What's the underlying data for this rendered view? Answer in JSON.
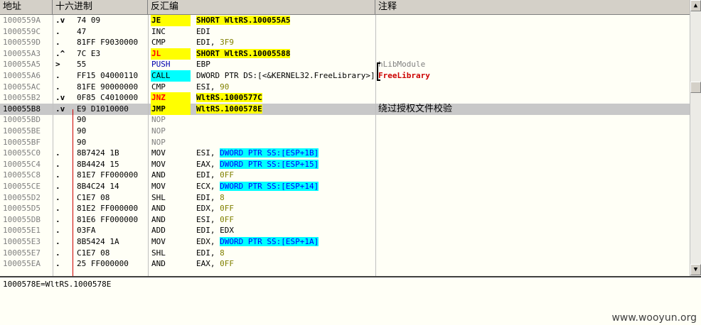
{
  "columns": {
    "address": "地址",
    "hex": "十六进制",
    "disasm": "反汇编",
    "comment": "注释"
  },
  "rows": [
    {
      "addr": "1000559A",
      "mark": ".v",
      "hex": "74 09",
      "mnem": "JE",
      "mstyle": "jmp",
      "ops": [
        {
          "t": "SHORT WltRS.100055A5",
          "c": "tgt"
        }
      ],
      "comment": ""
    },
    {
      "addr": "1000559C",
      "mark": ".",
      "hex": "47",
      "mnem": "INC",
      "mstyle": "",
      "ops": [
        {
          "t": "EDI",
          "c": ""
        }
      ],
      "comment": ""
    },
    {
      "addr": "1000559D",
      "mark": ".",
      "hex": "81FF F9030000",
      "mnem": "CMP",
      "mstyle": "",
      "ops": [
        {
          "t": "EDI, ",
          "c": ""
        },
        {
          "t": "3F9",
          "c": "imm"
        }
      ],
      "comment": ""
    },
    {
      "addr": "100055A3",
      "mark": ".^",
      "hex": "7C E3",
      "mnem": "JL",
      "mstyle": "jmpred",
      "ops": [
        {
          "t": "SHORT WltRS.10005588",
          "c": "tgt"
        }
      ],
      "comment": ""
    },
    {
      "addr": "100055A5",
      "mark": ">",
      "hex": "55",
      "mnem": "PUSH",
      "mstyle": "push",
      "ops": [
        {
          "t": "EBP",
          "c": ""
        }
      ],
      "comment": "hLibModule",
      "cstyle": "gray"
    },
    {
      "addr": "100055A6",
      "mark": ".",
      "hex": "FF15 04000110",
      "mnem": "CALL",
      "mstyle": "call",
      "ops": [
        {
          "t": "DWORD PTR DS:[<&KERNEL32.FreeLibrary>]",
          "c": ""
        }
      ],
      "comment": "FreeLibrary",
      "cstyle": "redtxt"
    },
    {
      "addr": "100055AC",
      "mark": ".",
      "hex": "81FE 90000000",
      "mnem": "CMP",
      "mstyle": "",
      "ops": [
        {
          "t": "ESI, ",
          "c": ""
        },
        {
          "t": "90",
          "c": "imm"
        }
      ],
      "comment": ""
    },
    {
      "addr": "100055B2",
      "mark": ".v",
      "hex": "0F85 C4010000",
      "mnem": "JNZ",
      "mstyle": "jmpred",
      "ops": [
        {
          "t": "WltRS.1000577C",
          "c": "tgt"
        }
      ],
      "comment": ""
    },
    {
      "addr": "100055B8",
      "mark": ".v",
      "hex": "E9 D1010000",
      "mnem": "JMP",
      "mstyle": "jmp",
      "ops": [
        {
          "t": "WltRS.1000578E",
          "c": "tgt"
        }
      ],
      "comment": "绕过授权文件校验",
      "selected": true
    },
    {
      "addr": "100055BD",
      "mark": "",
      "hex": "90",
      "mnem": "NOP",
      "mstyle": "nop",
      "ops": [],
      "comment": ""
    },
    {
      "addr": "100055BE",
      "mark": "",
      "hex": "90",
      "mnem": "NOP",
      "mstyle": "nop",
      "ops": [],
      "comment": ""
    },
    {
      "addr": "100055BF",
      "mark": "",
      "hex": "90",
      "mnem": "NOP",
      "mstyle": "nop",
      "ops": [],
      "comment": ""
    },
    {
      "addr": "100055C0",
      "mark": ".",
      "hex": "8B7424 1B",
      "mnem": "MOV",
      "mstyle": "",
      "ops": [
        {
          "t": "ESI, ",
          "c": ""
        },
        {
          "t": "DWORD PTR SS:[ESP+1B]",
          "c": "mem"
        }
      ],
      "comment": ""
    },
    {
      "addr": "100055C4",
      "mark": ".",
      "hex": "8B4424 15",
      "mnem": "MOV",
      "mstyle": "",
      "ops": [
        {
          "t": "EAX, ",
          "c": ""
        },
        {
          "t": "DWORD PTR SS:[ESP+15]",
          "c": "mem"
        }
      ],
      "comment": ""
    },
    {
      "addr": "100055C8",
      "mark": ".",
      "hex": "81E7 FF000000",
      "mnem": "AND",
      "mstyle": "",
      "ops": [
        {
          "t": "EDI, ",
          "c": ""
        },
        {
          "t": "0FF",
          "c": "imm"
        }
      ],
      "comment": ""
    },
    {
      "addr": "100055CE",
      "mark": ".",
      "hex": "8B4C24 14",
      "mnem": "MOV",
      "mstyle": "",
      "ops": [
        {
          "t": "ECX, ",
          "c": ""
        },
        {
          "t": "DWORD PTR SS:[ESP+14]",
          "c": "mem"
        }
      ],
      "comment": ""
    },
    {
      "addr": "100055D2",
      "mark": ".",
      "hex": "C1E7 08",
      "mnem": "SHL",
      "mstyle": "",
      "ops": [
        {
          "t": "EDI, ",
          "c": ""
        },
        {
          "t": "8",
          "c": "imm"
        }
      ],
      "comment": ""
    },
    {
      "addr": "100055D5",
      "mark": ".",
      "hex": "81E2 FF000000",
      "mnem": "AND",
      "mstyle": "",
      "ops": [
        {
          "t": "EDX, ",
          "c": ""
        },
        {
          "t": "0FF",
          "c": "imm"
        }
      ],
      "comment": ""
    },
    {
      "addr": "100055DB",
      "mark": ".",
      "hex": "81E6 FF000000",
      "mnem": "AND",
      "mstyle": "",
      "ops": [
        {
          "t": "ESI, ",
          "c": ""
        },
        {
          "t": "0FF",
          "c": "imm"
        }
      ],
      "comment": ""
    },
    {
      "addr": "100055E1",
      "mark": ".",
      "hex": "03FA",
      "mnem": "ADD",
      "mstyle": "",
      "ops": [
        {
          "t": "EDI, EDX",
          "c": ""
        }
      ],
      "comment": ""
    },
    {
      "addr": "100055E3",
      "mark": ".",
      "hex": "8B5424 1A",
      "mnem": "MOV",
      "mstyle": "",
      "ops": [
        {
          "t": "EDX, ",
          "c": ""
        },
        {
          "t": "DWORD PTR SS:[ESP+1A]",
          "c": "mem"
        }
      ],
      "comment": ""
    },
    {
      "addr": "100055E7",
      "mark": ".",
      "hex": "C1E7 08",
      "mnem": "SHL",
      "mstyle": "",
      "ops": [
        {
          "t": "EDI, ",
          "c": ""
        },
        {
          "t": "8",
          "c": "imm"
        }
      ],
      "comment": ""
    },
    {
      "addr": "100055EA",
      "mark": ".",
      "hex": "25 FF000000",
      "mnem": "AND",
      "mstyle": "",
      "ops": [
        {
          "t": "EAX, ",
          "c": ""
        },
        {
          "t": "0FF",
          "c": "imm"
        }
      ],
      "comment": ""
    }
  ],
  "info_line": "1000578E=WltRS.1000578E",
  "watermark": "www.wooyun.org",
  "colors": {
    "background": "#fffff6",
    "selected_row": "#c8c8c8",
    "jump_highlight": "#ffff00",
    "call_highlight": "#00ffff",
    "jump_arrow": "#cc0000"
  },
  "scrollbar": {
    "up_icon": "▲",
    "down_icon": "▼"
  }
}
